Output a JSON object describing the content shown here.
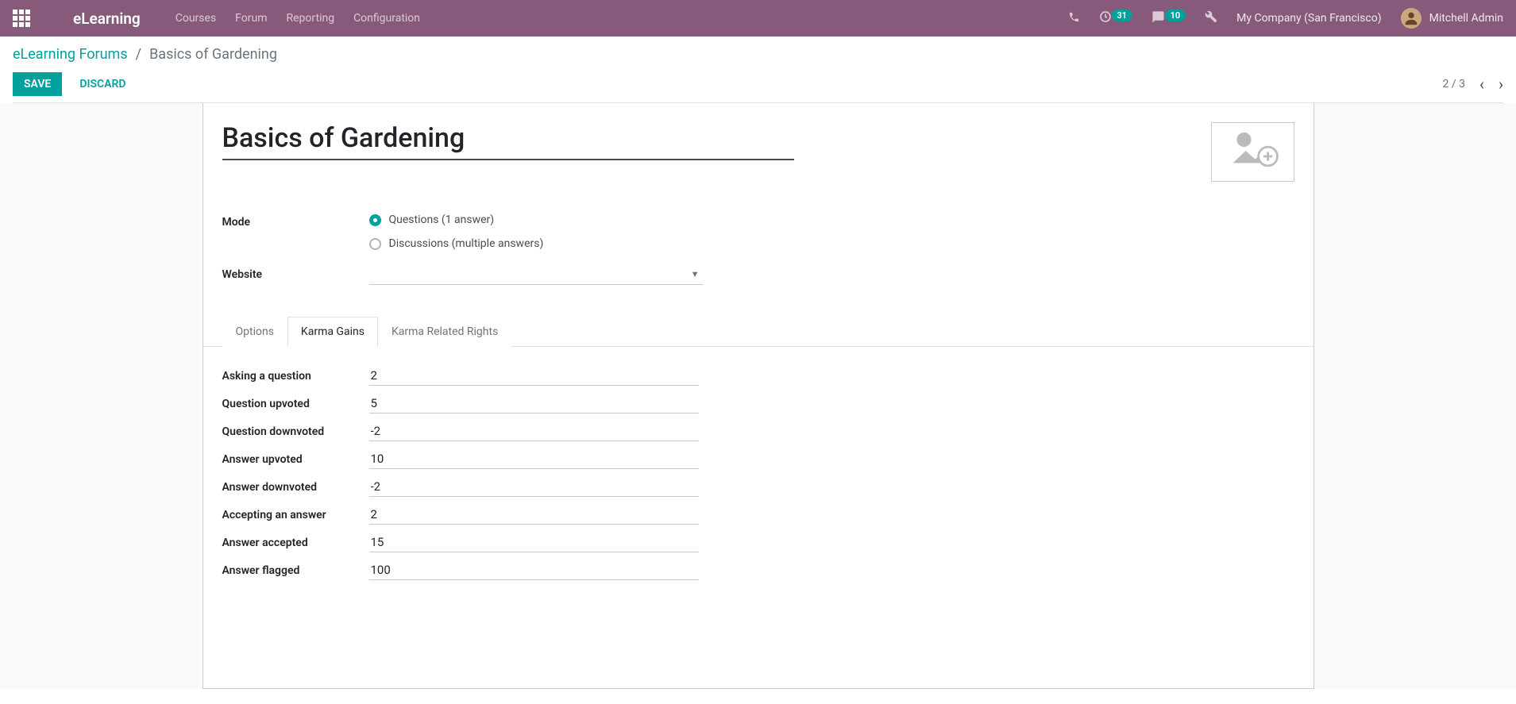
{
  "navbar": {
    "brand": "eLearning",
    "menu": [
      "Courses",
      "Forum",
      "Reporting",
      "Configuration"
    ],
    "badge_clock": "31",
    "badge_chat": "10",
    "company": "My Company (San Francisco)",
    "user": "Mitchell Admin"
  },
  "breadcrumb": {
    "parent": "eLearning Forums",
    "current": "Basics of Gardening"
  },
  "buttons": {
    "save": "SAVE",
    "discard": "DISCARD"
  },
  "pager": {
    "text": "2 / 3"
  },
  "form": {
    "title": "Basics of Gardening",
    "mode_label": "Mode",
    "mode_option_questions": "Questions (1 answer)",
    "mode_option_discussions": "Discussions (multiple answers)",
    "website_label": "Website"
  },
  "tabs": {
    "options": "Options",
    "karma_gains": "Karma Gains",
    "karma_rights": "Karma Related Rights"
  },
  "karma": {
    "asking_label": "Asking a question",
    "asking_value": "2",
    "q_upvoted_label": "Question upvoted",
    "q_upvoted_value": "5",
    "q_downvoted_label": "Question downvoted",
    "q_downvoted_value": "-2",
    "a_upvoted_label": "Answer upvoted",
    "a_upvoted_value": "10",
    "a_downvoted_label": "Answer downvoted",
    "a_downvoted_value": "-2",
    "accepting_label": "Accepting an answer",
    "accepting_value": "2",
    "accepted_label": "Answer accepted",
    "accepted_value": "15",
    "flagged_label": "Answer flagged",
    "flagged_value": "100"
  }
}
